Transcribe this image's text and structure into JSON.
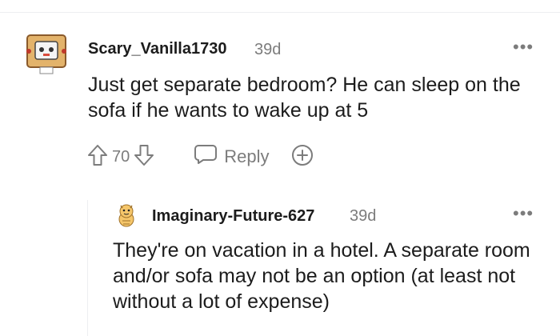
{
  "comment": {
    "author": "Scary_Vanilla1730",
    "time": "39d",
    "more": "•••",
    "text": "Just get separate bedroom? He can sleep on the sofa if he wants to wake up at 5",
    "votes": "70",
    "reply_label": "Reply"
  },
  "reply": {
    "author": "Imaginary-Future-627",
    "time": "39d",
    "more": "•••",
    "text": "They're on vacation in a hotel. A separate room and/or sofa may not be an option (at least not without a lot of expense)"
  },
  "colors": {
    "text": "#1c1c1c",
    "meta": "#7c7c7c",
    "divider": "#edeff1"
  },
  "icons": [
    "upvote-icon",
    "downvote-icon",
    "reply-icon",
    "award-icon",
    "more-icon"
  ]
}
